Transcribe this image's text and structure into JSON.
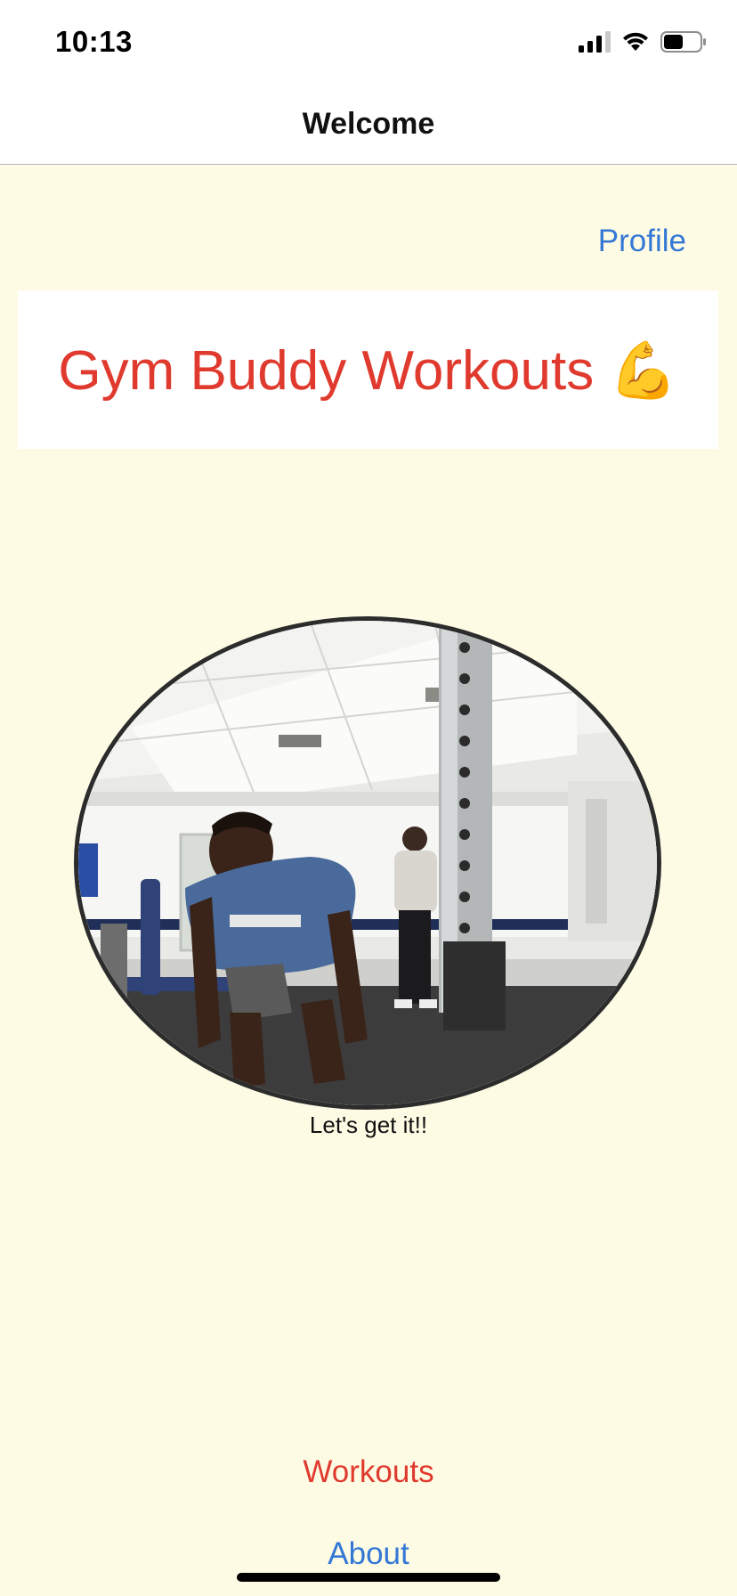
{
  "status_bar": {
    "time": "10:13",
    "icons": [
      "cellular-signal-icon",
      "wifi-icon",
      "battery-icon"
    ],
    "battery_level": 0.55
  },
  "nav": {
    "title": "Welcome"
  },
  "links": {
    "profile": "Profile",
    "workouts": "Workouts",
    "about": "About"
  },
  "header": {
    "title": "Gym Buddy Workouts 💪"
  },
  "hero": {
    "caption": "Let's get it!!"
  },
  "colors": {
    "background": "#fefbe5",
    "link_blue": "#3478d6",
    "accent_red": "#e03a2e"
  }
}
